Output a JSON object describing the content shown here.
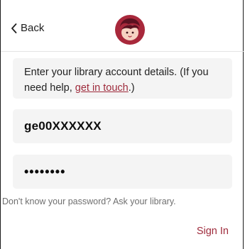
{
  "nav": {
    "back_label": "Back"
  },
  "info": {
    "text_before": "Enter your library account details. (If you need help, ",
    "link_text": "get in touch",
    "text_after": ".)"
  },
  "form": {
    "username_value": "ge00XXXXXX",
    "password_masked": "••••••••"
  },
  "hint": "Don't know your password? Ask your library.",
  "actions": {
    "sign_in_label": "Sign In"
  },
  "colors": {
    "accent": "#9e2a3b",
    "field_background": "#f4f4f4"
  },
  "icons": {
    "back": "chevron-left-icon",
    "logo": "libby-logo-icon"
  }
}
